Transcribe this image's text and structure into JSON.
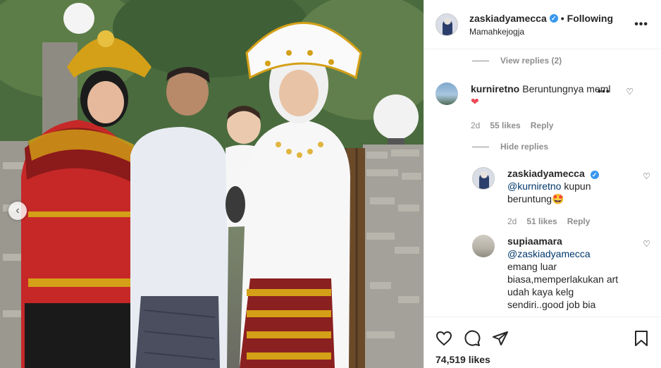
{
  "post": {
    "author": "zaskiadyamecca",
    "follow_state": "Following",
    "separator": "•",
    "location": "Mamahkejogja",
    "likes_count": "74,519 likes"
  },
  "comments": {
    "view_replies": "View replies (2)",
    "hide_replies": "Hide replies",
    "items": [
      {
        "username": "kurniretno",
        "text": "Beruntungnya meml",
        "emoji": "❤",
        "age": "2d",
        "likes": "55 likes",
        "reply": "Reply"
      },
      {
        "username": "zaskiadyamecca",
        "mention": "@kurniretno",
        "text": " kupun beruntung",
        "emoji": "🤩",
        "age": "2d",
        "likes": "51 likes",
        "reply": "Reply"
      },
      {
        "username": "supiaamara",
        "mention": "@zaskiadyamecca",
        "text": "emang luar biasa,memperlakukan art udah kaya kelg sendiri..good job bia"
      }
    ]
  },
  "icons": {
    "more": "more-horizontal-icon",
    "heart": "heart-icon",
    "comment": "comment-icon",
    "share": "share-icon",
    "save": "bookmark-icon",
    "prev": "chevron-left-icon",
    "verified": "verified-badge-icon"
  },
  "colors": {
    "accent": "#3897f0",
    "mention": "#00376b",
    "muted": "#8e8e8e",
    "like_red": "#ed4956"
  }
}
